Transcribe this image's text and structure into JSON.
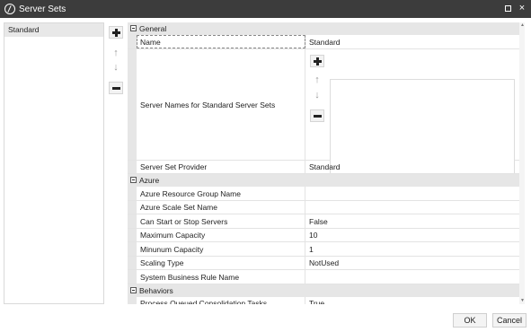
{
  "window": {
    "title": "Server Sets",
    "maximize_icon": "maximize-icon",
    "close_icon": "close-icon",
    "close_glyph": "×"
  },
  "server_sets_list": {
    "items": [
      "Standard"
    ]
  },
  "list_toolbar": {
    "add_icon": "plus-icon",
    "move_up_icon": "arrow-up-icon",
    "move_down_icon": "arrow-down-icon",
    "remove_icon": "minus-icon",
    "up_glyph": "↑",
    "down_glyph": "↓"
  },
  "property_grid": {
    "categories": {
      "general": "General",
      "azure": "Azure",
      "behaviors": "Behaviors"
    },
    "general": {
      "name_label": "Name",
      "name_value": "Standard",
      "server_names_label": "Server Names for Standard Server Sets",
      "server_names_items": [],
      "provider_label": "Server Set Provider",
      "provider_value": "Standard"
    },
    "azure": {
      "resource_group_label": "Azure Resource Group Name",
      "resource_group_value": "",
      "scale_set_label": "Azure Scale Set Name",
      "scale_set_value": "",
      "start_stop_label": "Can Start or Stop Servers",
      "start_stop_value": "False",
      "max_capacity_label": "Maximum Capacity",
      "max_capacity_value": "10",
      "min_capacity_label": "Minunum Capacity",
      "min_capacity_value": "1",
      "scaling_type_label": "Scaling Type",
      "scaling_type_value": "NotUsed",
      "business_rule_label": "System Business Rule Name",
      "business_rule_value": ""
    },
    "behaviors": {
      "queued_tasks_label": "Process Queued Consolidation Tasks",
      "queued_tasks_value": "True"
    }
  },
  "footer": {
    "ok_label": "OK",
    "cancel_label": "Cancel"
  }
}
